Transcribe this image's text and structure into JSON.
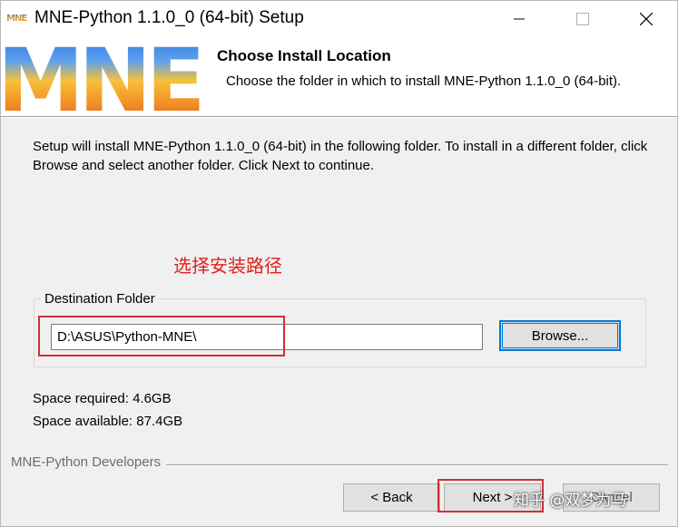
{
  "window": {
    "title": "MNE-Python 1.1.0_0 (64-bit) Setup",
    "icon_text": "MNE"
  },
  "header": {
    "logo_text": "MNE",
    "title": "Choose Install Location",
    "subtitle": "Choose the folder in which to install MNE-Python 1.1.0_0 (64-bit)."
  },
  "body": {
    "intro": "Setup will install MNE-Python 1.1.0_0 (64-bit) in the following folder. To install in a different folder, click Browse and select another folder. Click Next to continue.",
    "annotation": "选择安装路径",
    "destination": {
      "label": "Destination Folder",
      "value": "D:\\ASUS\\Python-MNE\\",
      "browse_label": "Browse..."
    },
    "space_required": "Space required: 4.6GB",
    "space_available": "Space available: 87.4GB"
  },
  "footer": {
    "branding": "MNE-Python Developers",
    "back_label": "< Back",
    "next_label": "Next >",
    "cancel_label": "Cancel"
  },
  "watermark": "知乎 @双梦为马",
  "colors": {
    "accent_blue": "#0078d7",
    "annotation_red": "#d32f2f",
    "window_bg": "#f0f0f0"
  }
}
